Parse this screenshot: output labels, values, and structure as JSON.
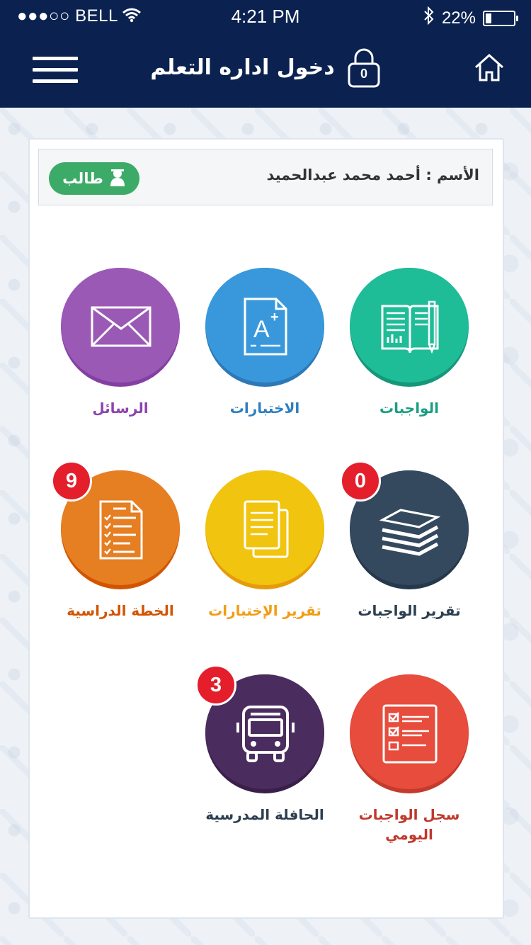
{
  "status_bar": {
    "carrier": "●●●○○ BELL",
    "time": "4:21 PM",
    "battery_percent": "22%",
    "battery_level": 0.22,
    "icons": [
      "wifi-icon",
      "bluetooth-icon",
      "battery-icon"
    ]
  },
  "header": {
    "title": "دخول اداره التعلم",
    "lock_count": "0",
    "icons": [
      "menu-icon",
      "lock-icon",
      "home-icon"
    ]
  },
  "user": {
    "name_label": "الأسم : أحمد محمد عبدالحميد",
    "role": "طالب"
  },
  "tiles": [
    {
      "label": "الواجبات",
      "color": "#1fbc98",
      "shade": "#15977a",
      "label_color": "#199e80",
      "icon": "book-icon",
      "badge": null
    },
    {
      "label": "الاختبارات",
      "color": "#3998db",
      "shade": "#2c79b6",
      "label_color": "#2e7fc0",
      "icon": "exam-grade-icon",
      "badge": null
    },
    {
      "label": "الرسائل",
      "color": "#9b59b6",
      "shade": "#8340a2",
      "label_color": "#8d44ad",
      "icon": "envelope-icon",
      "badge": null
    },
    {
      "label": "تقرير الواجبات",
      "color": "#34495e",
      "shade": "#26384b",
      "label_color": "#2c3e50",
      "icon": "layers-icon",
      "badge": "0"
    },
    {
      "label": "تقرير الإختبارات",
      "color": "#f1c40f",
      "shade": "#e59b0c",
      "label_color": "#f39c12",
      "icon": "documents-icon",
      "badge": null
    },
    {
      "label": "الخطة الدراسية",
      "color": "#e67e22",
      "shade": "#d35400",
      "label_color": "#d35400",
      "icon": "checklist-icon",
      "badge": "9"
    },
    {
      "label": "سجل الواجبات اليومي",
      "color": "#e74c3c",
      "shade": "#c43a2c",
      "label_color": "#c0392b",
      "icon": "daily-log-icon",
      "badge": null
    },
    {
      "label": "الحافلة المدرسية",
      "color": "#4b2c5e",
      "shade": "#3a1f4b",
      "label_color": "#2c3e50",
      "icon": "bus-icon",
      "badge": "3"
    }
  ]
}
